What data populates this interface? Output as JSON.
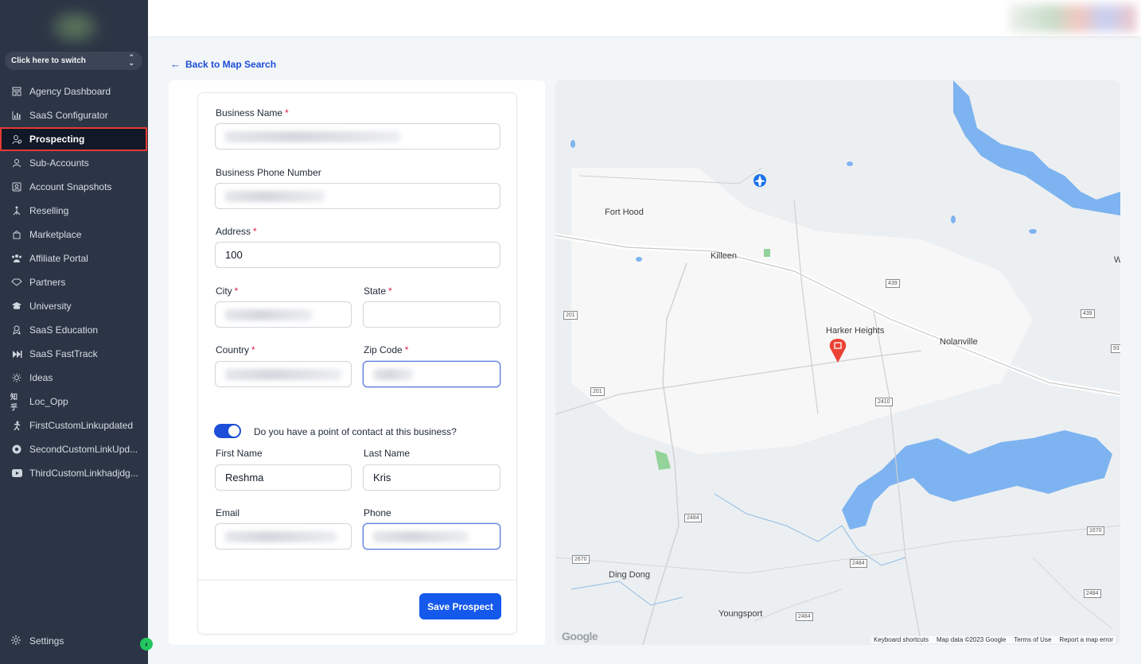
{
  "sidebar": {
    "switcher_label": "Click here to switch",
    "items": [
      {
        "label": "Agency Dashboard",
        "icon": "dashboard-icon"
      },
      {
        "label": "SaaS Configurator",
        "icon": "chart-icon"
      },
      {
        "label": "Prospecting",
        "icon": "prospecting-icon",
        "active": true
      },
      {
        "label": "Sub-Accounts",
        "icon": "user-icon"
      },
      {
        "label": "Account Snapshots",
        "icon": "snapshot-icon"
      },
      {
        "label": "Reselling",
        "icon": "reselling-icon"
      },
      {
        "label": "Marketplace",
        "icon": "shopping-bag-icon"
      },
      {
        "label": "Affiliate Portal",
        "icon": "group-icon"
      },
      {
        "label": "Partners",
        "icon": "handshake-icon"
      },
      {
        "label": "University",
        "icon": "graduation-cap-icon"
      },
      {
        "label": "SaaS Education",
        "icon": "education-icon"
      },
      {
        "label": "SaaS FastTrack",
        "icon": "fast-forward-icon"
      },
      {
        "label": "Ideas",
        "icon": "lightbulb-icon"
      },
      {
        "label": "Loc_Opp",
        "icon": "zhihu-icon"
      },
      {
        "label": "FirstCustomLinkupdated",
        "icon": "running-person-icon"
      },
      {
        "label": "SecondCustomLinkUpd...",
        "icon": "chrome-icon"
      },
      {
        "label": "ThirdCustomLinkhadjdg...",
        "icon": "youtube-icon"
      }
    ],
    "settings_label": "Settings"
  },
  "back_link": "Back to Map Search",
  "form": {
    "business_name_label": "Business Name",
    "business_phone_label": "Business Phone Number",
    "address_label": "Address",
    "address_value": "100",
    "city_label": "City",
    "state_label": "State",
    "country_label": "Country",
    "zip_label": "Zip Code",
    "required_mark": "*",
    "contact_question": "Do you have a point of contact at this business?",
    "first_name_label": "First Name",
    "first_name_value": "Reshma",
    "last_name_label": "Last Name",
    "last_name_value": "Kris",
    "email_label": "Email",
    "phone_label": "Phone",
    "save_label": "Save Prospect"
  },
  "map": {
    "places": [
      "Fort Hood",
      "Killeen",
      "Harker Heights",
      "Nolanville",
      "Ding Dong",
      "Youngsport",
      "W"
    ],
    "shields": [
      "439",
      "439",
      "201",
      "201",
      "2410",
      "2484",
      "2484",
      "2484",
      "2484",
      "1670",
      "2670",
      "93"
    ],
    "google_logo": "Google",
    "footer": [
      "Keyboard shortcuts",
      "Map data ©2023 Google",
      "Terms of Use",
      "Report a map error"
    ]
  }
}
